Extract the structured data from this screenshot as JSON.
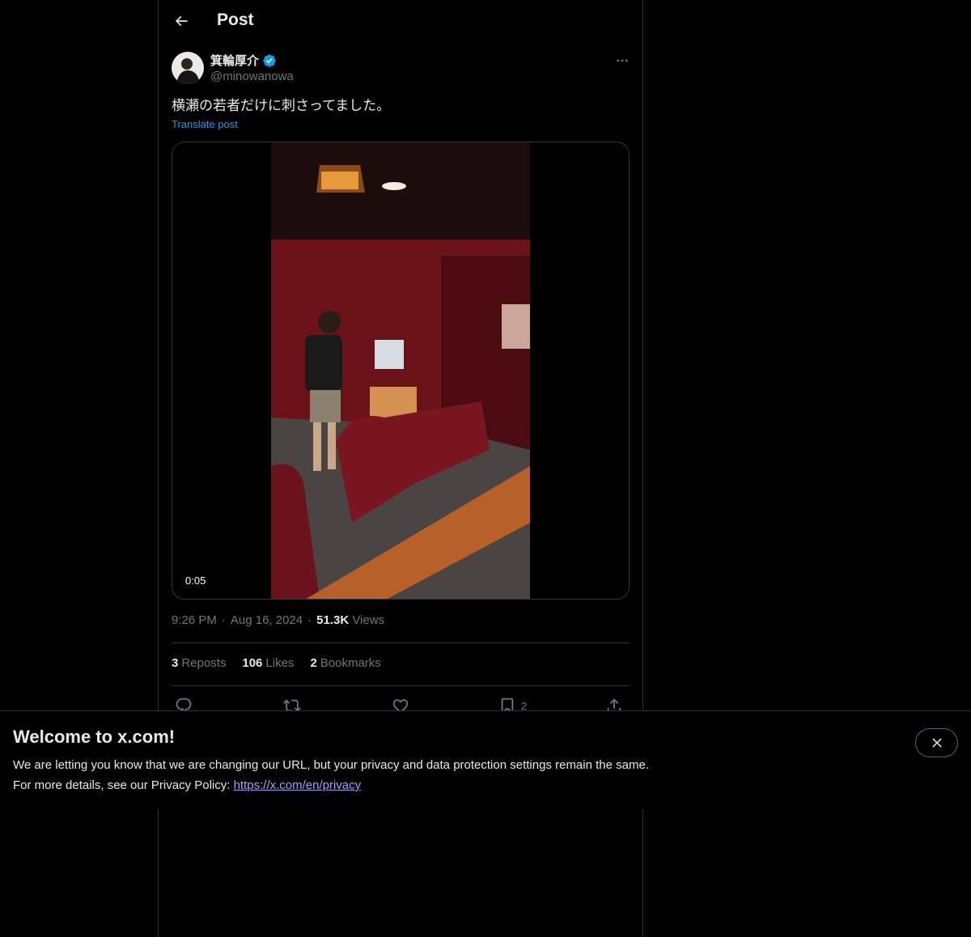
{
  "header": {
    "title": "Post"
  },
  "author": {
    "display_name": "箕輪厚介",
    "handle": "@minowanowa",
    "verified": true
  },
  "post": {
    "text": "横瀬の若者だけに刺さってました。",
    "translate_label": "Translate post",
    "media": {
      "type": "video",
      "duration": "0:05"
    },
    "time": "9:26 PM",
    "date": "Aug 16, 2024",
    "views_count": "51.3K",
    "views_label": "Views",
    "separator": "·"
  },
  "stats": {
    "reposts_count": "3",
    "reposts_label": "Reposts",
    "likes_count": "106",
    "likes_label": "Likes",
    "bookmarks_count": "2",
    "bookmarks_label": "Bookmarks"
  },
  "actions": {
    "bookmark_count": "2"
  },
  "banner": {
    "title": "Welcome to x.com!",
    "line1": "We are letting you know that we are changing our URL, but your privacy and data protection settings remain the same.",
    "line2_prefix": "For more details, see our Privacy Policy: ",
    "link_text": "https://x.com/en/privacy"
  },
  "colors": {
    "background": "#000000",
    "text_primary": "#e7e9ea",
    "text_secondary": "#71767b",
    "accent": "#1d9bf0",
    "border": "#2f3336",
    "link_visited": "#a99cf5"
  },
  "icons": {
    "back": "arrow-left-icon",
    "verified": "verified-badge-icon",
    "more": "more-horizontal-icon",
    "reply": "reply-icon",
    "repost": "repost-icon",
    "like": "heart-icon",
    "bookmark": "bookmark-icon",
    "share": "share-icon",
    "close": "close-icon"
  }
}
